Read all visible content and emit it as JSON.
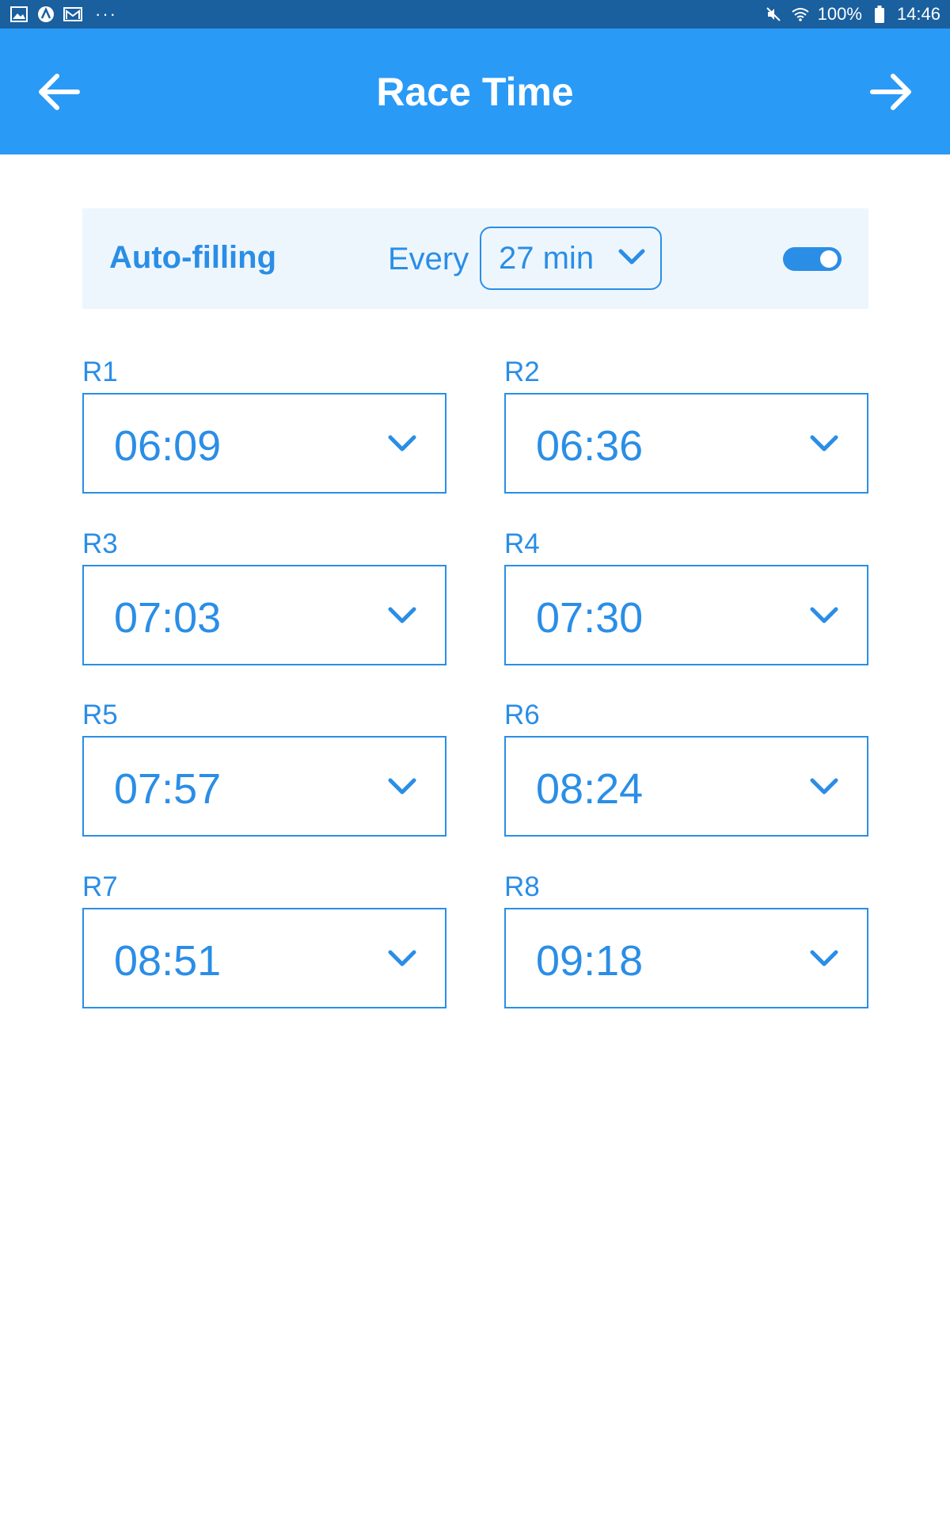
{
  "status_bar": {
    "battery": "100%",
    "time": "14:46",
    "dots": "···"
  },
  "app_bar": {
    "title": "Race Time"
  },
  "autofill": {
    "label": "Auto-filling",
    "every_label": "Every",
    "interval": "27 min",
    "enabled": true
  },
  "races": [
    {
      "label": "R1",
      "time": "06:09"
    },
    {
      "label": "R2",
      "time": "06:36"
    },
    {
      "label": "R3",
      "time": "07:03"
    },
    {
      "label": "R4",
      "time": "07:30"
    },
    {
      "label": "R5",
      "time": "07:57"
    },
    {
      "label": "R6",
      "time": "08:24"
    },
    {
      "label": "R7",
      "time": "08:51"
    },
    {
      "label": "R8",
      "time": "09:18"
    }
  ],
  "colors": {
    "status_bar": "#1a5f9e",
    "app_bar": "#2a9af7",
    "accent": "#2a8ee6",
    "panel_bg": "#eef6fd"
  }
}
